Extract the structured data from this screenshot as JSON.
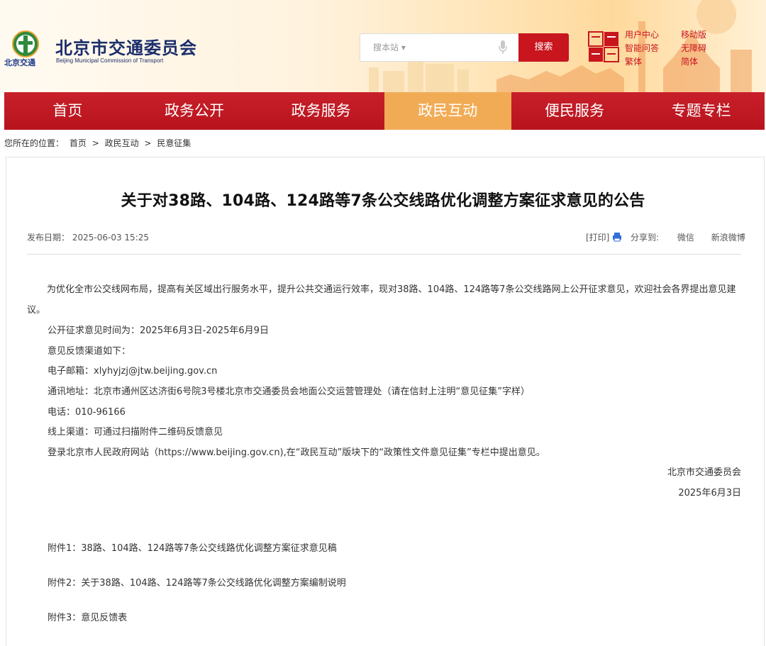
{
  "header": {
    "logo_text": "北京交通",
    "site_title": "北京市交通委员会",
    "site_subtitle": "Beijing Municipal Commission of Transport",
    "search_placeholder": "搜本站 ▾",
    "search_button": "搜索",
    "quick_links": [
      "用户中心",
      "移动版",
      "智能问答",
      "无障碍",
      "繁体",
      "简体"
    ],
    "accent_color": "#c8151e"
  },
  "nav": {
    "items": [
      "首页",
      "政务公开",
      "政务服务",
      "政民互动",
      "便民服务",
      "专题专栏"
    ],
    "active": "政民互动",
    "active_color": "#f2ab55"
  },
  "breadcrumb": {
    "prefix": "您所在的位置：",
    "items": [
      "首页",
      "政民互动",
      "民意征集"
    ],
    "separator": ">"
  },
  "article": {
    "title": "关于对38路、104路、124路等7条公交线路优化调整方案征求意见的公告",
    "publish_label": "发布日期：",
    "publish_date": "2025-06-03 15:25",
    "print_label": "[打印]",
    "share_label": "分享到:",
    "share_wechat": "微信",
    "share_weibo": "新浪微博",
    "intro": "为优化全市公交线网布局，提高有关区域出行服务水平，提升公共交通运行效率，现对38路、104路、124路等7条公交线路网上公开征求意见，欢迎社会各界提出意见建议。",
    "lines": [
      "公开征求意见时间为：2025年6月3日-2025年6月9日",
      "意见反馈渠道如下：",
      "电子邮箱：xlyhyjzj@jtw.beijing.gov.cn",
      "通讯地址：北京市通州区达济街6号院3号楼北京市交通委员会地面公交运营管理处（请在信封上注明“意见征集”字样）",
      "电话：010-96166",
      "线上渠道：可通过扫描附件二维码反馈意见",
      "登录北京市人民政府网站（https://www.beijing.gov.cn),在“政民互动”版块下的“政策性文件意见征集”专栏中提出意见。"
    ],
    "signature_org": "北京市交通委员会",
    "signature_date": "2025年6月3日",
    "attachments": [
      "附件1：38路、104路、124路等7条公交线路优化调整方案征求意见稿",
      "附件2：关于38路、104路、124路等7条公交线路优化调整方案编制说明",
      "附件3：意见反馈表"
    ]
  }
}
